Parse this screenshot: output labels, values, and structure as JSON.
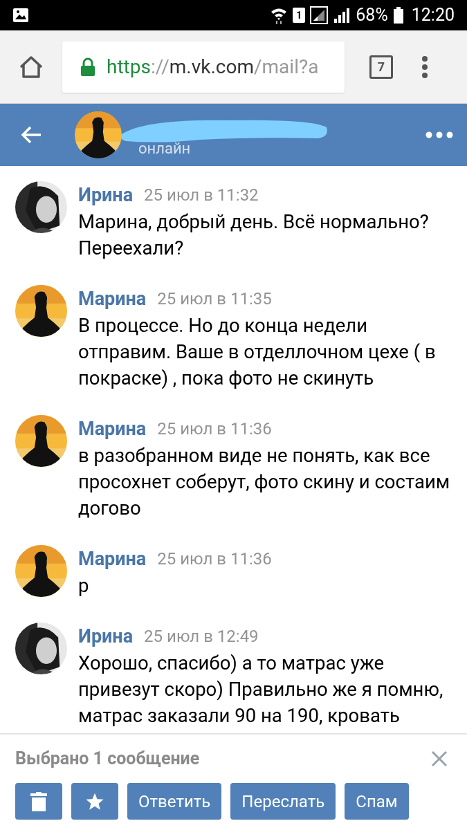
{
  "status_bar": {
    "sim": "1",
    "battery": "68%",
    "time": "12:20"
  },
  "browser": {
    "url": {
      "scheme": "https",
      "separator": "://",
      "host": "m.vk.com",
      "path": "/mail?a"
    },
    "tab_count": "7"
  },
  "header": {
    "status": "онлайн",
    "name_redacted": true
  },
  "messages": [
    {
      "kind": "portrait",
      "author": "Ирина",
      "time": "25 июл в 11:32",
      "text": "Марина, добрый день. Всё нормально? Переехали?"
    },
    {
      "kind": "sunset",
      "author": "Марина",
      "time": "25 июл в 11:35",
      "text": "В процессе. Но до конца недели отправим. Ваше в отделлочном цехе ( в покраске) , пока фото не скинуть"
    },
    {
      "kind": "sunset",
      "author": "Марина",
      "time": "25 июл в 11:36",
      "text": "в разобранном виде не понять, как все просохнет соберут, фото скину и состаим догово"
    },
    {
      "kind": "sunset",
      "author": "Марина",
      "time": "25 июл в 11:36",
      "text": "р"
    },
    {
      "kind": "portrait",
      "author": "Ирина",
      "time": "25 июл в 12:49",
      "text": "Хорошо, спасибо) а то матрас уже привезут скоро) Правильно же я помню, матрас заказали 90 на 190, кровать"
    }
  ],
  "selection": {
    "title": "Выбрано 1 сообщение",
    "actions": [
      {
        "kind": "delete"
      },
      {
        "kind": "favorite"
      },
      {
        "kind": "text",
        "label": "Ответить"
      },
      {
        "kind": "text",
        "label": "Переслать"
      },
      {
        "kind": "text",
        "label": "Спам"
      }
    ]
  }
}
